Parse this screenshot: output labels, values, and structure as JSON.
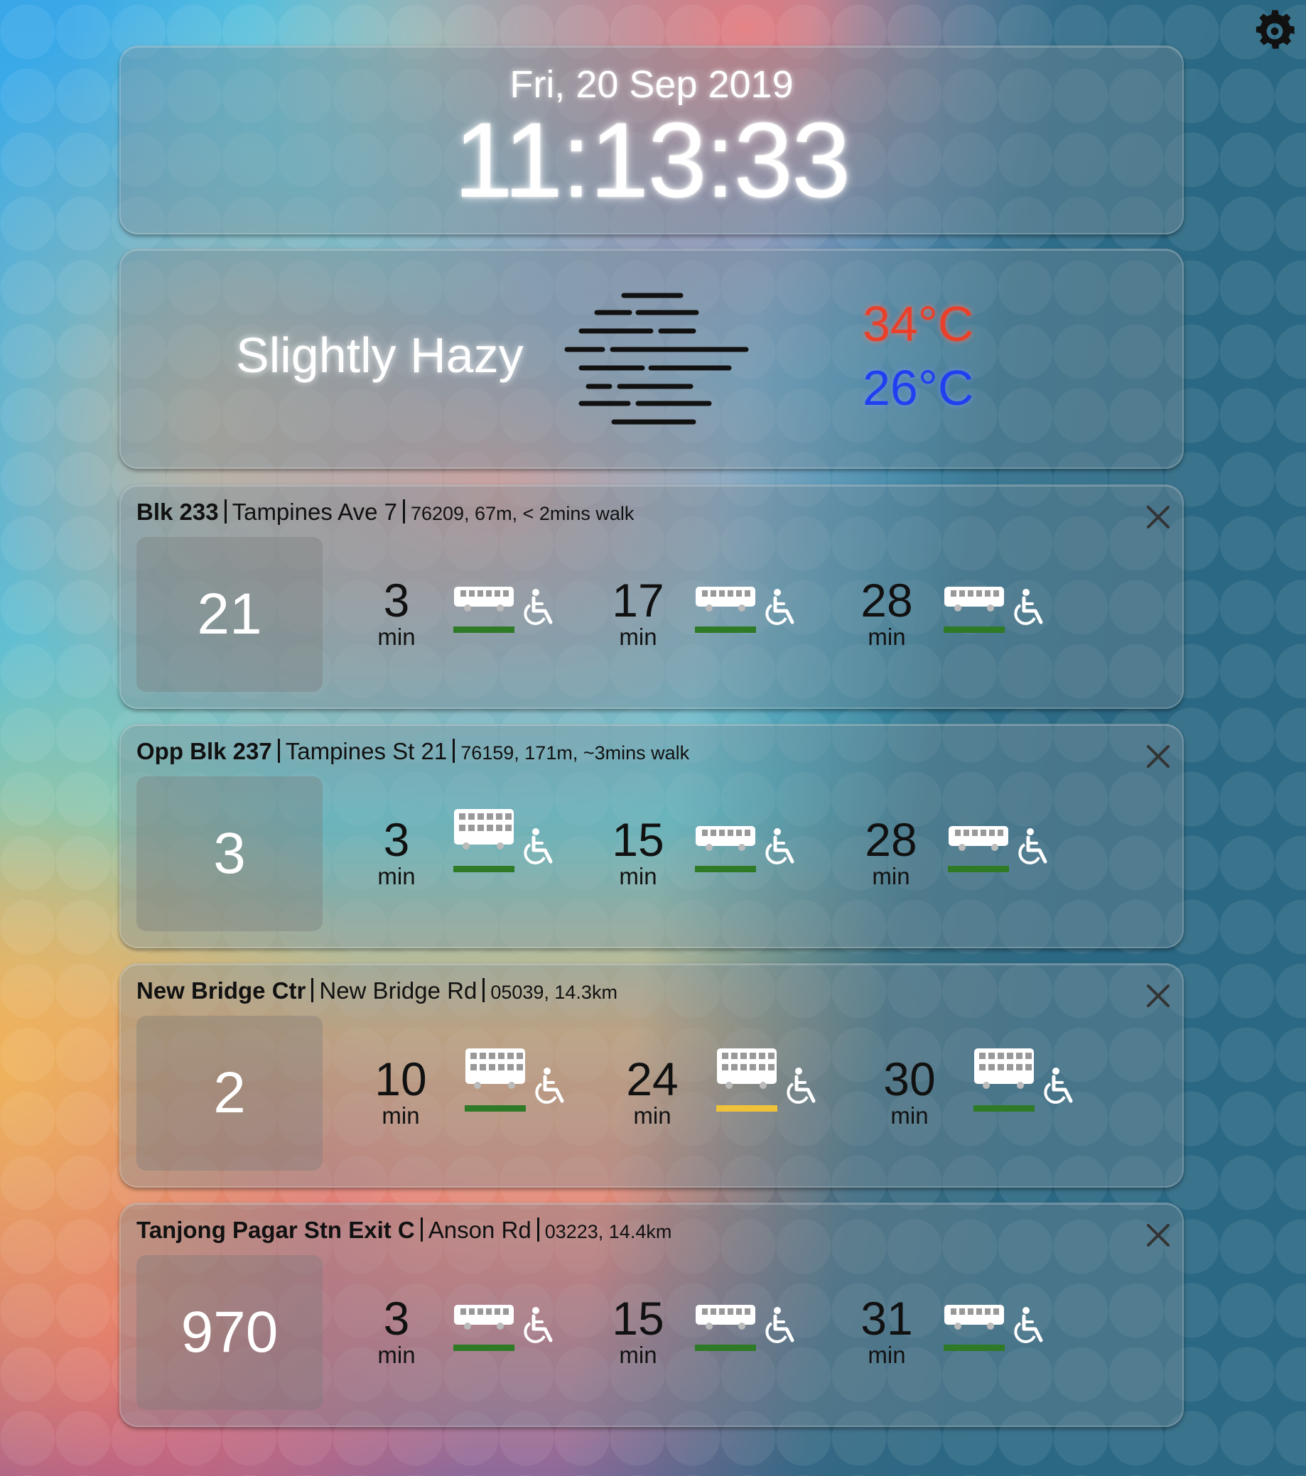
{
  "clock": {
    "date": "Fri, 20 Sep 2019",
    "time": "11:13:33"
  },
  "settings_icon": "gear-icon",
  "weather": {
    "condition": "Slightly Hazy",
    "icon": "haze-icon",
    "high": "34°C",
    "low": "26°C",
    "high_color": "#e8402a",
    "low_color": "#2040f0"
  },
  "stops": [
    {
      "name": "Blk 233",
      "road": "Tampines Ave 7",
      "info": "76209, 67m, < 2mins walk",
      "service": "21",
      "arrivals": [
        {
          "mins": "3",
          "unit": "min",
          "bus": "single-deck",
          "load": "green",
          "wab": true
        },
        {
          "mins": "17",
          "unit": "min",
          "bus": "single-deck",
          "load": "green",
          "wab": true
        },
        {
          "mins": "28",
          "unit": "min",
          "bus": "single-deck",
          "load": "green",
          "wab": true
        }
      ]
    },
    {
      "name": "Opp Blk 237",
      "road": "Tampines St 21",
      "info": "76159, 171m, ~3mins walk",
      "service": "3",
      "arrivals": [
        {
          "mins": "3",
          "unit": "min",
          "bus": "double-deck",
          "load": "green",
          "wab": true
        },
        {
          "mins": "15",
          "unit": "min",
          "bus": "single-deck",
          "load": "green",
          "wab": true
        },
        {
          "mins": "28",
          "unit": "min",
          "bus": "single-deck",
          "load": "green",
          "wab": true
        }
      ]
    },
    {
      "name": "New Bridge Ctr",
      "road": "New Bridge Rd",
      "info": "05039, 14.3km",
      "service": "2",
      "arrivals": [
        {
          "mins": "10",
          "unit": "min",
          "bus": "double-deck",
          "load": "green",
          "wab": true
        },
        {
          "mins": "24",
          "unit": "min",
          "bus": "double-deck",
          "load": "yellow",
          "wab": true
        },
        {
          "mins": "30",
          "unit": "min",
          "bus": "double-deck",
          "load": "green",
          "wab": true
        }
      ]
    },
    {
      "name": "Tanjong Pagar Stn Exit C",
      "road": "Anson Rd",
      "info": "03223, 14.4km",
      "service": "970",
      "arrivals": [
        {
          "mins": "3",
          "unit": "min",
          "bus": "single-deck",
          "load": "green",
          "wab": true
        },
        {
          "mins": "15",
          "unit": "min",
          "bus": "single-deck",
          "load": "green",
          "wab": true
        },
        {
          "mins": "31",
          "unit": "min",
          "bus": "single-deck",
          "load": "green",
          "wab": true
        }
      ]
    }
  ],
  "load_colors": {
    "green": "#2e7a26",
    "yellow": "#f0c23a"
  }
}
